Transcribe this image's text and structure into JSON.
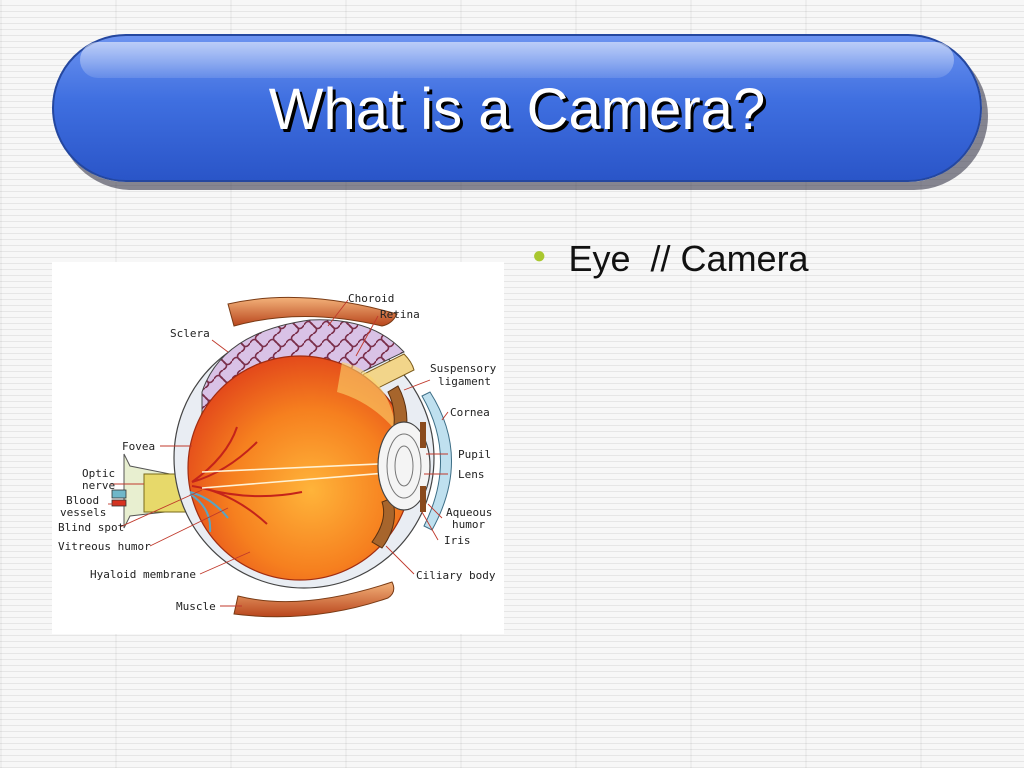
{
  "slide": {
    "title": "What is a Camera?",
    "bullets": [
      {
        "text": "Eye  // Camera"
      }
    ]
  },
  "diagram": {
    "labels": {
      "choroid": "Choroid",
      "retina": "Retina",
      "sclera": "Sclera",
      "suspensory": "Suspensory",
      "ligament": "ligament",
      "cornea": "Cornea",
      "fovea": "Fovea",
      "pupil": "Pupil",
      "optic1": "Optic",
      "optic2": "nerve",
      "lens": "Lens",
      "blood1": "Blood",
      "blood2": "vessels",
      "aqueous1": "Aqueous",
      "aqueous2": "humor",
      "blindspot": "Blind spot",
      "iris": "Iris",
      "vitreous": "Vitreous humor",
      "hyaloid": "Hyaloid membrane",
      "ciliary": "Ciliary body",
      "muscle": "Muscle"
    }
  },
  "colors": {
    "title_bar": "#3f6fe0",
    "bullet": "#a9c72f",
    "vitreous": "#f26b1d"
  }
}
